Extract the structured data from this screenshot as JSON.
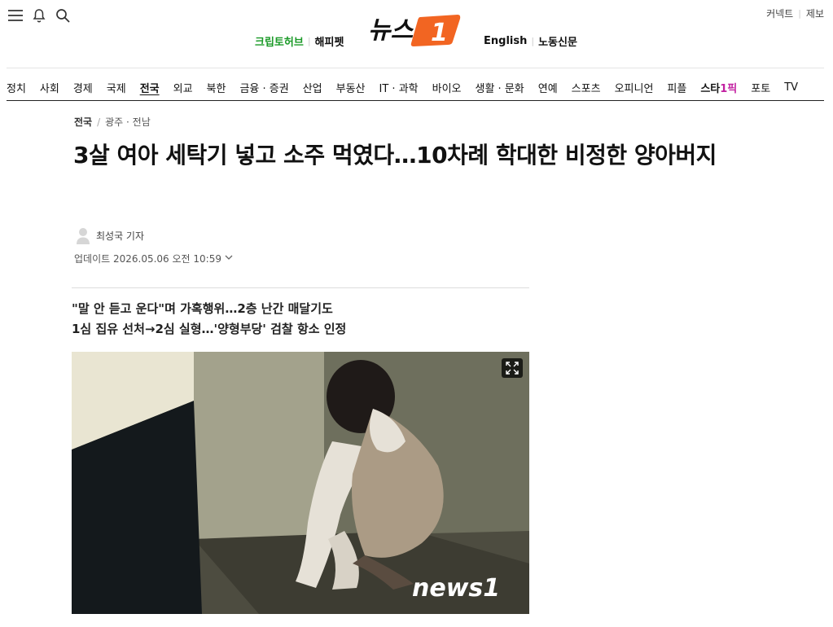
{
  "header": {
    "top_right": [
      "커넥트",
      "제보"
    ],
    "partners_left": [
      {
        "label": "크립토허브",
        "color": "#1b9a28"
      },
      {
        "label": "해피펫",
        "color": "#111111"
      }
    ],
    "partners_right": [
      "English",
      "노동신문"
    ],
    "logo": {
      "name": "news1-logo",
      "text_left": "뉴스",
      "mark": "1",
      "accent": "#f26522"
    }
  },
  "nav": {
    "items": [
      "정치",
      "사회",
      "경제",
      "국제",
      "전국",
      "외교",
      "북한",
      "금융 · 증권",
      "산업",
      "부동산",
      "IT · 과학",
      "바이오",
      "생활 · 문화",
      "연예",
      "스포츠",
      "오피니언",
      "피플"
    ],
    "active": "전국",
    "star_a": "스타",
    "star_b": "1픽",
    "after": [
      "포토",
      "TV"
    ]
  },
  "article": {
    "breadcrumb": [
      "전국",
      "광주 · 전남"
    ],
    "headline": "3살 여아 세탁기 넣고 소주 먹였다…10차례 학대한 비정한 양아버지",
    "reporter": "최성국 기자",
    "updated": "업데이트 2026.05.06 오전 10:59",
    "subheads": [
      "\"말 안 듣고 운다\"며 가혹행위…2층 난간 매달기도",
      "1심 집유 선처→2심 실형…'양형부당' 검찰 항소 인정"
    ],
    "photo_watermark": "news1"
  },
  "icons": [
    "menu-icon",
    "bell-icon",
    "search-icon",
    "expand-icon",
    "chevron-down-icon"
  ],
  "colors": {
    "accent": "#f26522",
    "green": "#1b9a28",
    "pink": "#c21fa0"
  }
}
